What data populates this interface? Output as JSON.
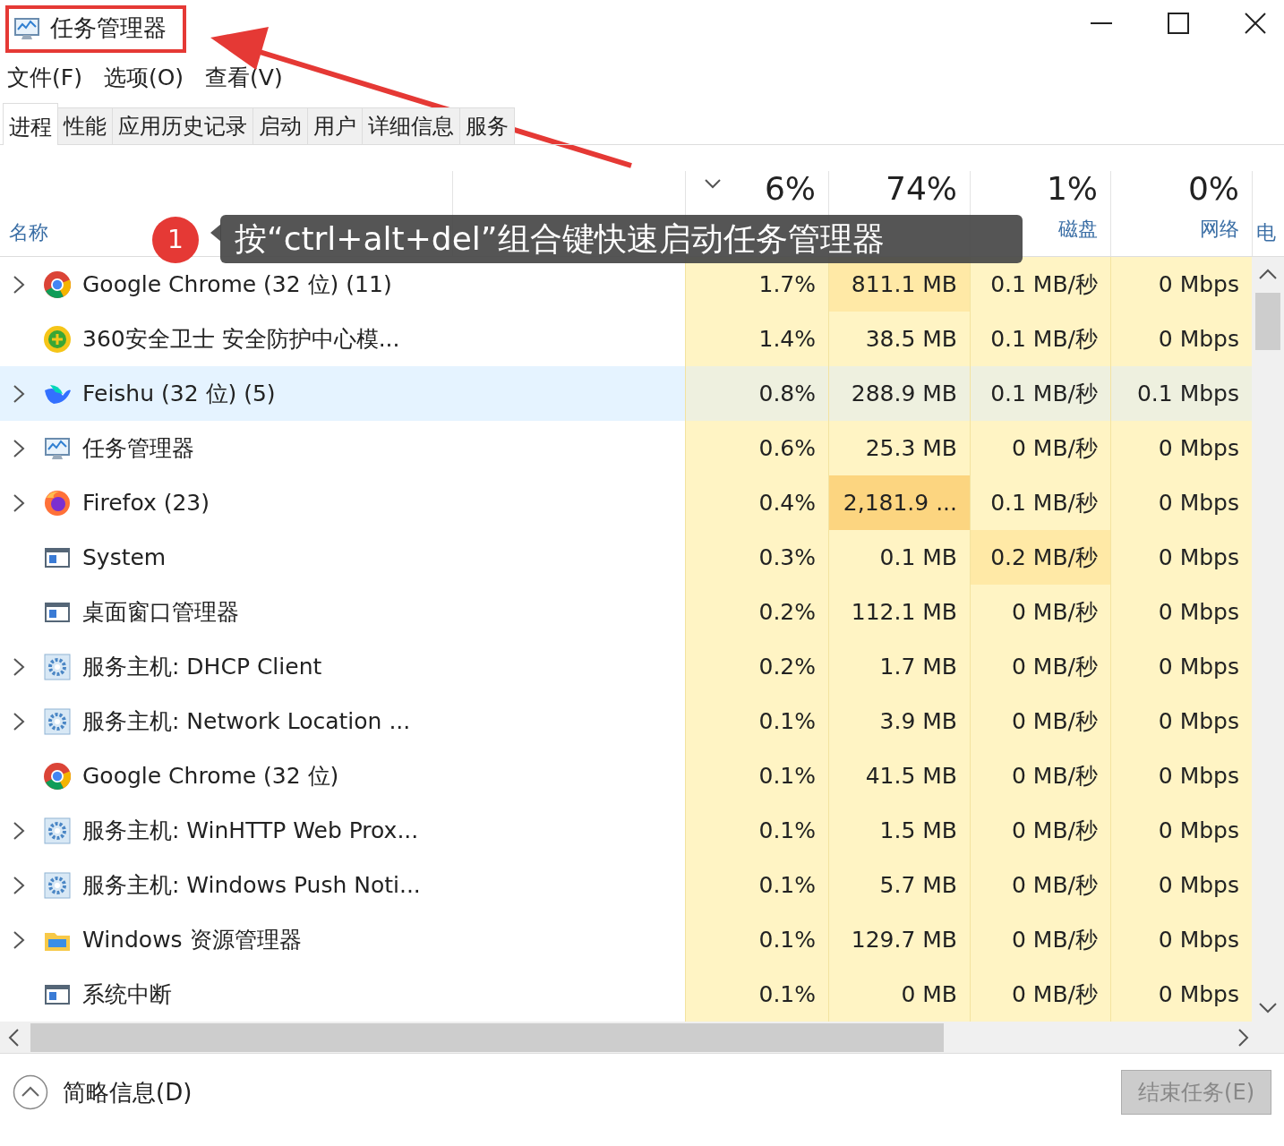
{
  "window": {
    "title": "任务管理器"
  },
  "menu": [
    "文件(F)",
    "选项(O)",
    "查看(V)"
  ],
  "tabs": [
    {
      "label": "进程",
      "selected": true
    },
    {
      "label": "性能",
      "selected": false
    },
    {
      "label": "应用历史记录",
      "selected": false
    },
    {
      "label": "启动",
      "selected": false
    },
    {
      "label": "用户",
      "selected": false
    },
    {
      "label": "详细信息",
      "selected": false
    },
    {
      "label": "服务",
      "selected": false
    }
  ],
  "columns": [
    {
      "kind": "name",
      "label": "名称"
    },
    {
      "kind": "status"
    },
    {
      "kind": "metric",
      "percent": "6%",
      "sorted": true
    },
    {
      "kind": "metric",
      "percent": "74%",
      "sorted": false
    },
    {
      "kind": "metric",
      "percent": "1%",
      "label": "磁盘",
      "sorted": false
    },
    {
      "kind": "metric",
      "percent": "0%",
      "label": "网络",
      "sorted": false
    },
    {
      "kind": "cut",
      "label": "电"
    }
  ],
  "rows": [
    {
      "name": "Google Chrome (32 位) (11)",
      "expandable": true,
      "selected": false,
      "cells": [
        {
          "text": "1.7%",
          "color": "#fff4c4"
        },
        {
          "text": "811.1 MB",
          "color": "#ffe9a6"
        },
        {
          "text": "0.1 MB/秒",
          "color": "#fff4c4"
        },
        {
          "text": "0 Mbps",
          "color": "#fff4c4"
        }
      ]
    },
    {
      "name": "360安全卫士 安全防护中心模...",
      "expandable": false,
      "selected": false,
      "cells": [
        {
          "text": "1.4%",
          "color": "#fff4c4"
        },
        {
          "text": "38.5 MB",
          "color": "#fff4c4"
        },
        {
          "text": "0.1 MB/秒",
          "color": "#fff4c4"
        },
        {
          "text": "0 Mbps",
          "color": "#fff4c4"
        }
      ]
    },
    {
      "name": "Feishu (32 位) (5)",
      "expandable": true,
      "selected": true,
      "cells": [
        {
          "text": "0.8%",
          "color": "#eef0df"
        },
        {
          "text": "288.9 MB",
          "color": "#eef0df"
        },
        {
          "text": "0.1 MB/秒",
          "color": "#eef0df"
        },
        {
          "text": "0.1 Mbps",
          "color": "#eef0df"
        }
      ]
    },
    {
      "name": "任务管理器",
      "expandable": true,
      "selected": false,
      "cells": [
        {
          "text": "0.6%",
          "color": "#fff4c4"
        },
        {
          "text": "25.3 MB",
          "color": "#fff4c4"
        },
        {
          "text": "0 MB/秒",
          "color": "#fff4c4"
        },
        {
          "text": "0 Mbps",
          "color": "#fff4c4"
        }
      ]
    },
    {
      "name": "Firefox (23)",
      "expandable": true,
      "selected": false,
      "cells": [
        {
          "text": "0.4%",
          "color": "#fff4c4"
        },
        {
          "text": "2,181.9 ...",
          "color": "#fcd580"
        },
        {
          "text": "0.1 MB/秒",
          "color": "#fff4c4"
        },
        {
          "text": "0 Mbps",
          "color": "#fff4c4"
        }
      ]
    },
    {
      "name": "System",
      "expandable": false,
      "selected": false,
      "cells": [
        {
          "text": "0.3%",
          "color": "#fff4c4"
        },
        {
          "text": "0.1 MB",
          "color": "#fff4c4"
        },
        {
          "text": "0.2 MB/秒",
          "color": "#ffe9a6"
        },
        {
          "text": "0 Mbps",
          "color": "#fff4c4"
        }
      ]
    },
    {
      "name": "桌面窗口管理器",
      "expandable": false,
      "selected": false,
      "cells": [
        {
          "text": "0.2%",
          "color": "#fff4c4"
        },
        {
          "text": "112.1 MB",
          "color": "#fff4c4"
        },
        {
          "text": "0 MB/秒",
          "color": "#fff4c4"
        },
        {
          "text": "0 Mbps",
          "color": "#fff4c4"
        }
      ]
    },
    {
      "name": "服务主机: DHCP Client",
      "expandable": true,
      "selected": false,
      "cells": [
        {
          "text": "0.2%",
          "color": "#fff4c4"
        },
        {
          "text": "1.7 MB",
          "color": "#fff4c4"
        },
        {
          "text": "0 MB/秒",
          "color": "#fff4c4"
        },
        {
          "text": "0 Mbps",
          "color": "#fff4c4"
        }
      ]
    },
    {
      "name": "服务主机: Network Location ...",
      "expandable": true,
      "selected": false,
      "cells": [
        {
          "text": "0.1%",
          "color": "#fff4c4"
        },
        {
          "text": "3.9 MB",
          "color": "#fff4c4"
        },
        {
          "text": "0 MB/秒",
          "color": "#fff4c4"
        },
        {
          "text": "0 Mbps",
          "color": "#fff4c4"
        }
      ]
    },
    {
      "name": "Google Chrome (32 位)",
      "expandable": false,
      "selected": false,
      "cells": [
        {
          "text": "0.1%",
          "color": "#fff4c4"
        },
        {
          "text": "41.5 MB",
          "color": "#fff4c4"
        },
        {
          "text": "0 MB/秒",
          "color": "#fff4c4"
        },
        {
          "text": "0 Mbps",
          "color": "#fff4c4"
        }
      ]
    },
    {
      "name": "服务主机: WinHTTP Web Prox...",
      "expandable": true,
      "selected": false,
      "cells": [
        {
          "text": "0.1%",
          "color": "#fff4c4"
        },
        {
          "text": "1.5 MB",
          "color": "#fff4c4"
        },
        {
          "text": "0 MB/秒",
          "color": "#fff4c4"
        },
        {
          "text": "0 Mbps",
          "color": "#fff4c4"
        }
      ]
    },
    {
      "name": "服务主机: Windows Push Noti...",
      "expandable": true,
      "selected": false,
      "cells": [
        {
          "text": "0.1%",
          "color": "#fff4c4"
        },
        {
          "text": "5.7 MB",
          "color": "#fff4c4"
        },
        {
          "text": "0 MB/秒",
          "color": "#fff4c4"
        },
        {
          "text": "0 Mbps",
          "color": "#fff4c4"
        }
      ]
    },
    {
      "name": "Windows 资源管理器",
      "expandable": true,
      "selected": false,
      "cells": [
        {
          "text": "0.1%",
          "color": "#fff4c4"
        },
        {
          "text": "129.7 MB",
          "color": "#fff4c4"
        },
        {
          "text": "0 MB/秒",
          "color": "#fff4c4"
        },
        {
          "text": "0 Mbps",
          "color": "#fff4c4"
        }
      ]
    },
    {
      "name": "系统中断",
      "expandable": false,
      "selected": false,
      "cells": [
        {
          "text": "0.1%",
          "color": "#fff4c4"
        },
        {
          "text": "0 MB",
          "color": "#fff4c4"
        },
        {
          "text": "0 MB/秒",
          "color": "#fff4c4"
        },
        {
          "text": "0 Mbps",
          "color": "#fff4c4"
        }
      ]
    }
  ],
  "footer": {
    "details": "简略信息(D)",
    "end_task": {
      "label": "结束任务(E)",
      "disabled": true
    }
  },
  "annotation": {
    "badge": "1",
    "text": "按“ctrl+alt+del”组合键快速启动任务管理器"
  }
}
